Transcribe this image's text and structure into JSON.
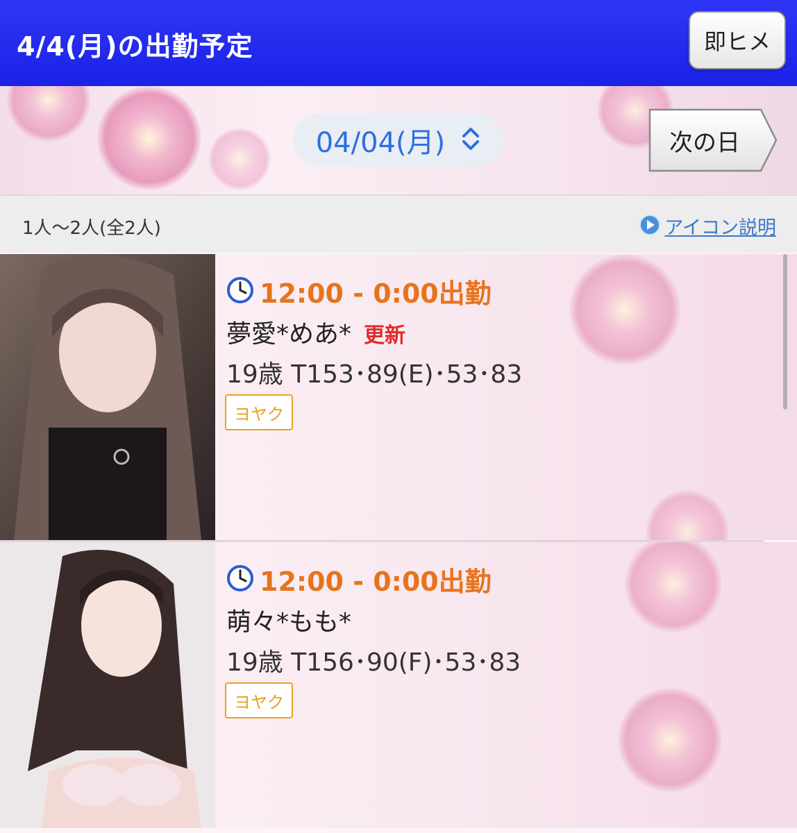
{
  "header": {
    "title": "4/4(月)の出勤予定",
    "instant_button": "即ヒメ"
  },
  "date_selector": {
    "value": "04/04(月)",
    "next_button": "次の日"
  },
  "list_info": {
    "count": "1人〜2人(全2人)",
    "icon_help_link": "アイコン説明"
  },
  "cast": [
    {
      "shift": "12:00 - 0:00出勤",
      "name": "夢愛*めあ*",
      "badge": "更新",
      "stats": "19歳 T153･89(E)･53･83",
      "reserve": "ヨヤク"
    },
    {
      "shift": "12:00 - 0:00出勤",
      "name": "萌々*もも*",
      "badge": "",
      "stats": "19歳 T156･90(F)･53･83",
      "reserve": "ヨヤク"
    }
  ],
  "colors": {
    "header_blue": "#1a22e8",
    "shift_orange": "#e8731c",
    "update_red": "#e32a2a",
    "reserve_gold": "#e7a21f",
    "link_blue": "#3a78c9",
    "date_blue": "#2b6fe0"
  },
  "icons": [
    "clock-icon",
    "play-circle-icon",
    "updown-chevron-icon",
    "arrow-right-icon"
  ]
}
